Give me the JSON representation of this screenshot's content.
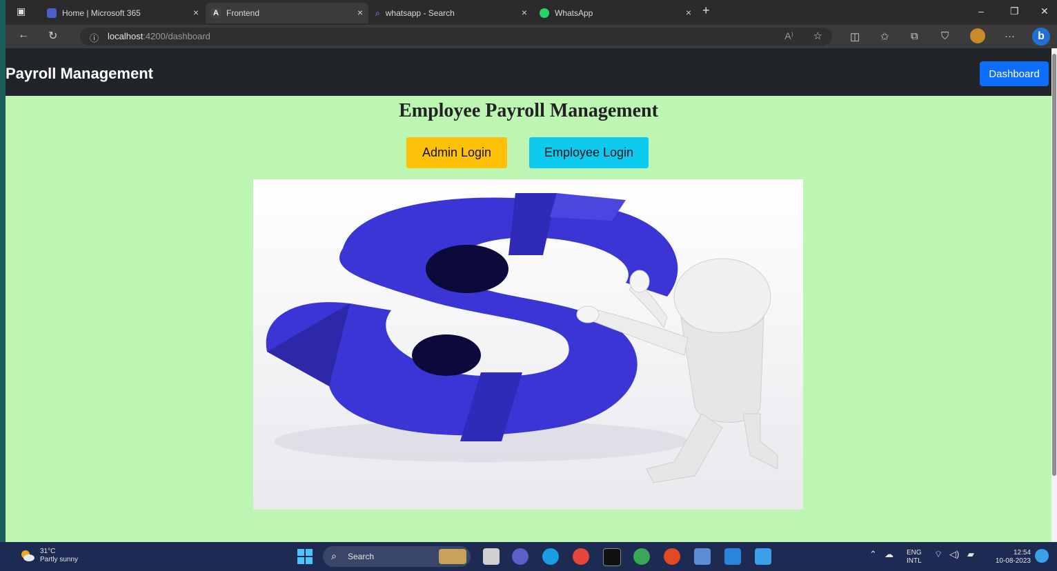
{
  "browser": {
    "tabs": [
      {
        "label": "Home | Microsoft 365",
        "icon": "microsoft365-icon",
        "close": "×"
      },
      {
        "label": "Frontend",
        "icon": "angular-icon",
        "close": "×"
      },
      {
        "label": "whatsapp - Search",
        "icon": "search-icon",
        "close": "×"
      },
      {
        "label": "WhatsApp",
        "icon": "whatsapp-icon",
        "close": "×"
      }
    ],
    "new_tab": "+",
    "address": {
      "host": "localhost",
      "path": ":4200/dashboard"
    }
  },
  "app": {
    "brand": "Payroll Management",
    "nav_button": "Dashboard",
    "heading": "Employee Payroll Management",
    "admin_login": "Admin Login",
    "employee_login": "Employee Login"
  },
  "taskbar": {
    "weather_temp": "31°C",
    "weather_desc": "Partly sunny",
    "search": "Search",
    "lang_top": "ENG",
    "lang_bottom": "INTL",
    "time": "12:54",
    "date": "10-08-2023"
  },
  "colors": {
    "page_bg": "#bdf5b3",
    "navbar_bg": "#212529",
    "primary": "#0d6efd",
    "warning": "#ffc107",
    "info": "#0dcaf0",
    "dollar": "#3a35d4"
  }
}
